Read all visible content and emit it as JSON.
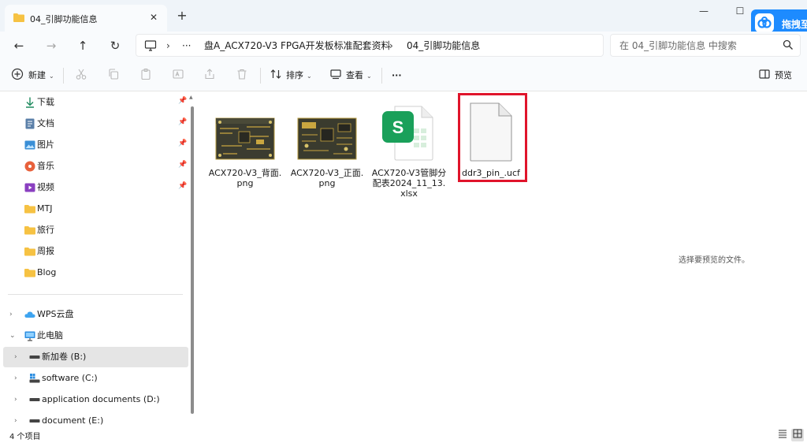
{
  "tab": {
    "title": "04_引脚功能信息",
    "close": "✕",
    "new_tab": "+"
  },
  "window": {
    "minimize": "—",
    "maximize": "☐"
  },
  "baidu_widget": {
    "label": "拖拽至"
  },
  "nav": {
    "back": "←",
    "forward": "→",
    "up": "↑",
    "refresh": "↻"
  },
  "address": {
    "more": "···",
    "sep": "›",
    "crumbs": [
      "盘A_ACX720-V3 FPGA开发板标准配套资料",
      "04_引脚功能信息"
    ]
  },
  "search": {
    "placeholder": "在 04_引脚功能信息 中搜索"
  },
  "toolbar": {
    "new_label": "新建",
    "sort_label": "排序",
    "view_label": "查看",
    "more": "···",
    "preview_label": "预览",
    "caret": "⌄"
  },
  "sidebar": {
    "quick": [
      {
        "label": "下载",
        "icon": "download-icon",
        "pin": "📌"
      },
      {
        "label": "文档",
        "icon": "document-icon",
        "pin": "📌"
      },
      {
        "label": "图片",
        "icon": "pictures-icon",
        "pin": "📌"
      },
      {
        "label": "音乐",
        "icon": "music-icon",
        "pin": "📌"
      },
      {
        "label": "视频",
        "icon": "video-icon",
        "pin": "📌"
      },
      {
        "label": "MTJ",
        "icon": "folder-icon"
      },
      {
        "label": "旅行",
        "icon": "folder-icon"
      },
      {
        "label": "周报",
        "icon": "folder-icon"
      },
      {
        "label": "Blog",
        "icon": "folder-icon"
      }
    ],
    "tree": [
      {
        "label": "WPS云盘",
        "chevron": "›",
        "icon": "cloud-icon"
      },
      {
        "label": "此电脑",
        "chevron": "⌄",
        "icon": "computer-icon"
      },
      {
        "label": "新加卷 (B:)",
        "chevron": "›",
        "icon": "drive-icon",
        "selected": true
      },
      {
        "label": "software (C:)",
        "chevron": "›",
        "icon": "system-drive-icon"
      },
      {
        "label": "application documents (D:)",
        "chevron": "›",
        "icon": "drive-icon"
      },
      {
        "label": "document (E:)",
        "chevron": "›",
        "icon": "drive-icon"
      }
    ]
  },
  "files": [
    {
      "name": "ACX720-V3_背面.png",
      "type": "pcb-image"
    },
    {
      "name": "ACX720-V3_正面.png",
      "type": "pcb-image"
    },
    {
      "name": "ACX720-V3管脚分配表2024_11_13.xlsx",
      "type": "spreadsheet"
    },
    {
      "name": "ddr3_pin_.ucf",
      "type": "generic-file",
      "highlighted": true
    }
  ],
  "preview_message": "选择要预览的文件。",
  "status": {
    "item_count": "4 个项目"
  },
  "colors": {
    "highlight": "#e0142b",
    "folder": "#f6c243",
    "accent": "#1d8bff",
    "wps_green": "#1aa05a"
  }
}
